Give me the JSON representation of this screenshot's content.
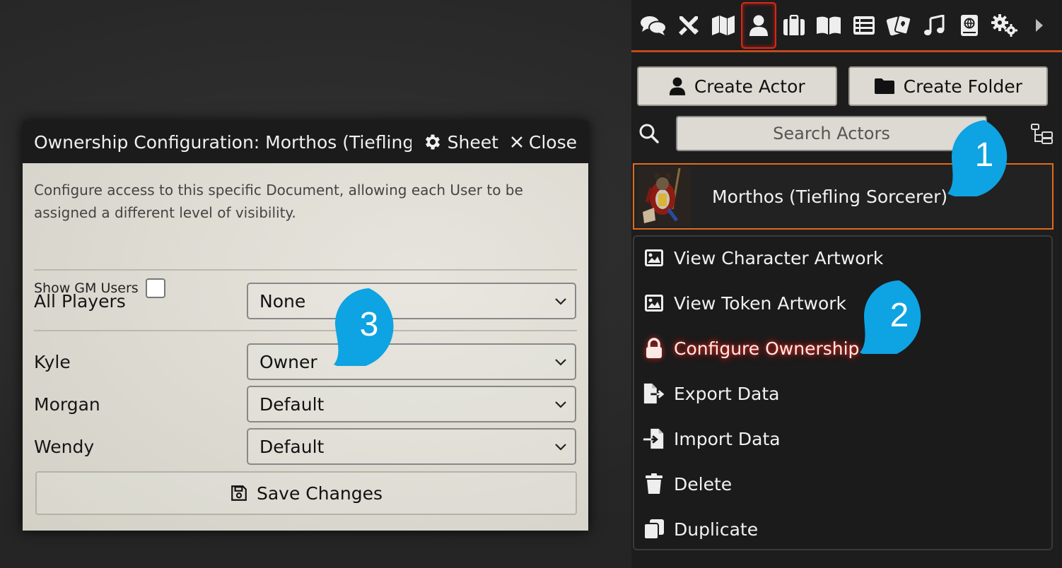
{
  "dialog": {
    "title": "Ownership Configuration: Morthos (Tiefling",
    "sheet_label": "Sheet",
    "close_label": "Close",
    "hint": "Configure access to this specific Document, allowing each User to be assigned a different level of visibility.",
    "show_gm_label": "Show GM Users",
    "show_gm_checked": false,
    "all_players": {
      "label": "All Players",
      "value": "None"
    },
    "users": [
      {
        "label": "Kyle",
        "value": "Owner"
      },
      {
        "label": "Morgan",
        "value": "Default"
      },
      {
        "label": "Wendy",
        "value": "Default"
      }
    ],
    "save_label": "Save Changes"
  },
  "sidebar": {
    "tabs": [
      {
        "name": "chat",
        "icon": "comments-icon"
      },
      {
        "name": "combat",
        "icon": "crossed-swords-icon"
      },
      {
        "name": "scenes",
        "icon": "map-icon"
      },
      {
        "name": "actors",
        "icon": "user-icon",
        "active": true
      },
      {
        "name": "items",
        "icon": "suitcase-icon"
      },
      {
        "name": "journal",
        "icon": "book-open-icon"
      },
      {
        "name": "tables",
        "icon": "th-list-icon"
      },
      {
        "name": "cards",
        "icon": "cards-icon"
      },
      {
        "name": "playlists",
        "icon": "music-icon"
      },
      {
        "name": "compendium",
        "icon": "atlas-icon"
      },
      {
        "name": "settings",
        "icon": "cogs-icon"
      },
      {
        "name": "collapse",
        "icon": "caret-right-icon"
      }
    ],
    "create_actor_label": "Create Actor",
    "create_folder_label": "Create Folder",
    "search_placeholder": "Search Actors",
    "actor_name": "Morthos (Tiefling Sorcerer)",
    "context_menu": [
      {
        "label": "View Character Artwork",
        "icon": "image-icon"
      },
      {
        "label": "View Token Artwork",
        "icon": "image-icon"
      },
      {
        "label": "Configure Ownership",
        "icon": "lock-icon",
        "active": true
      },
      {
        "label": "Export Data",
        "icon": "file-export-icon"
      },
      {
        "label": "Import Data",
        "icon": "file-import-icon"
      },
      {
        "label": "Delete",
        "icon": "trash-icon"
      },
      {
        "label": "Duplicate",
        "icon": "copy-icon"
      }
    ]
  },
  "callouts": [
    "1",
    "2",
    "3"
  ],
  "colors": {
    "accent": "#e06b1c",
    "callout": "#0ea3e2",
    "active_glow": "#e3241a"
  }
}
